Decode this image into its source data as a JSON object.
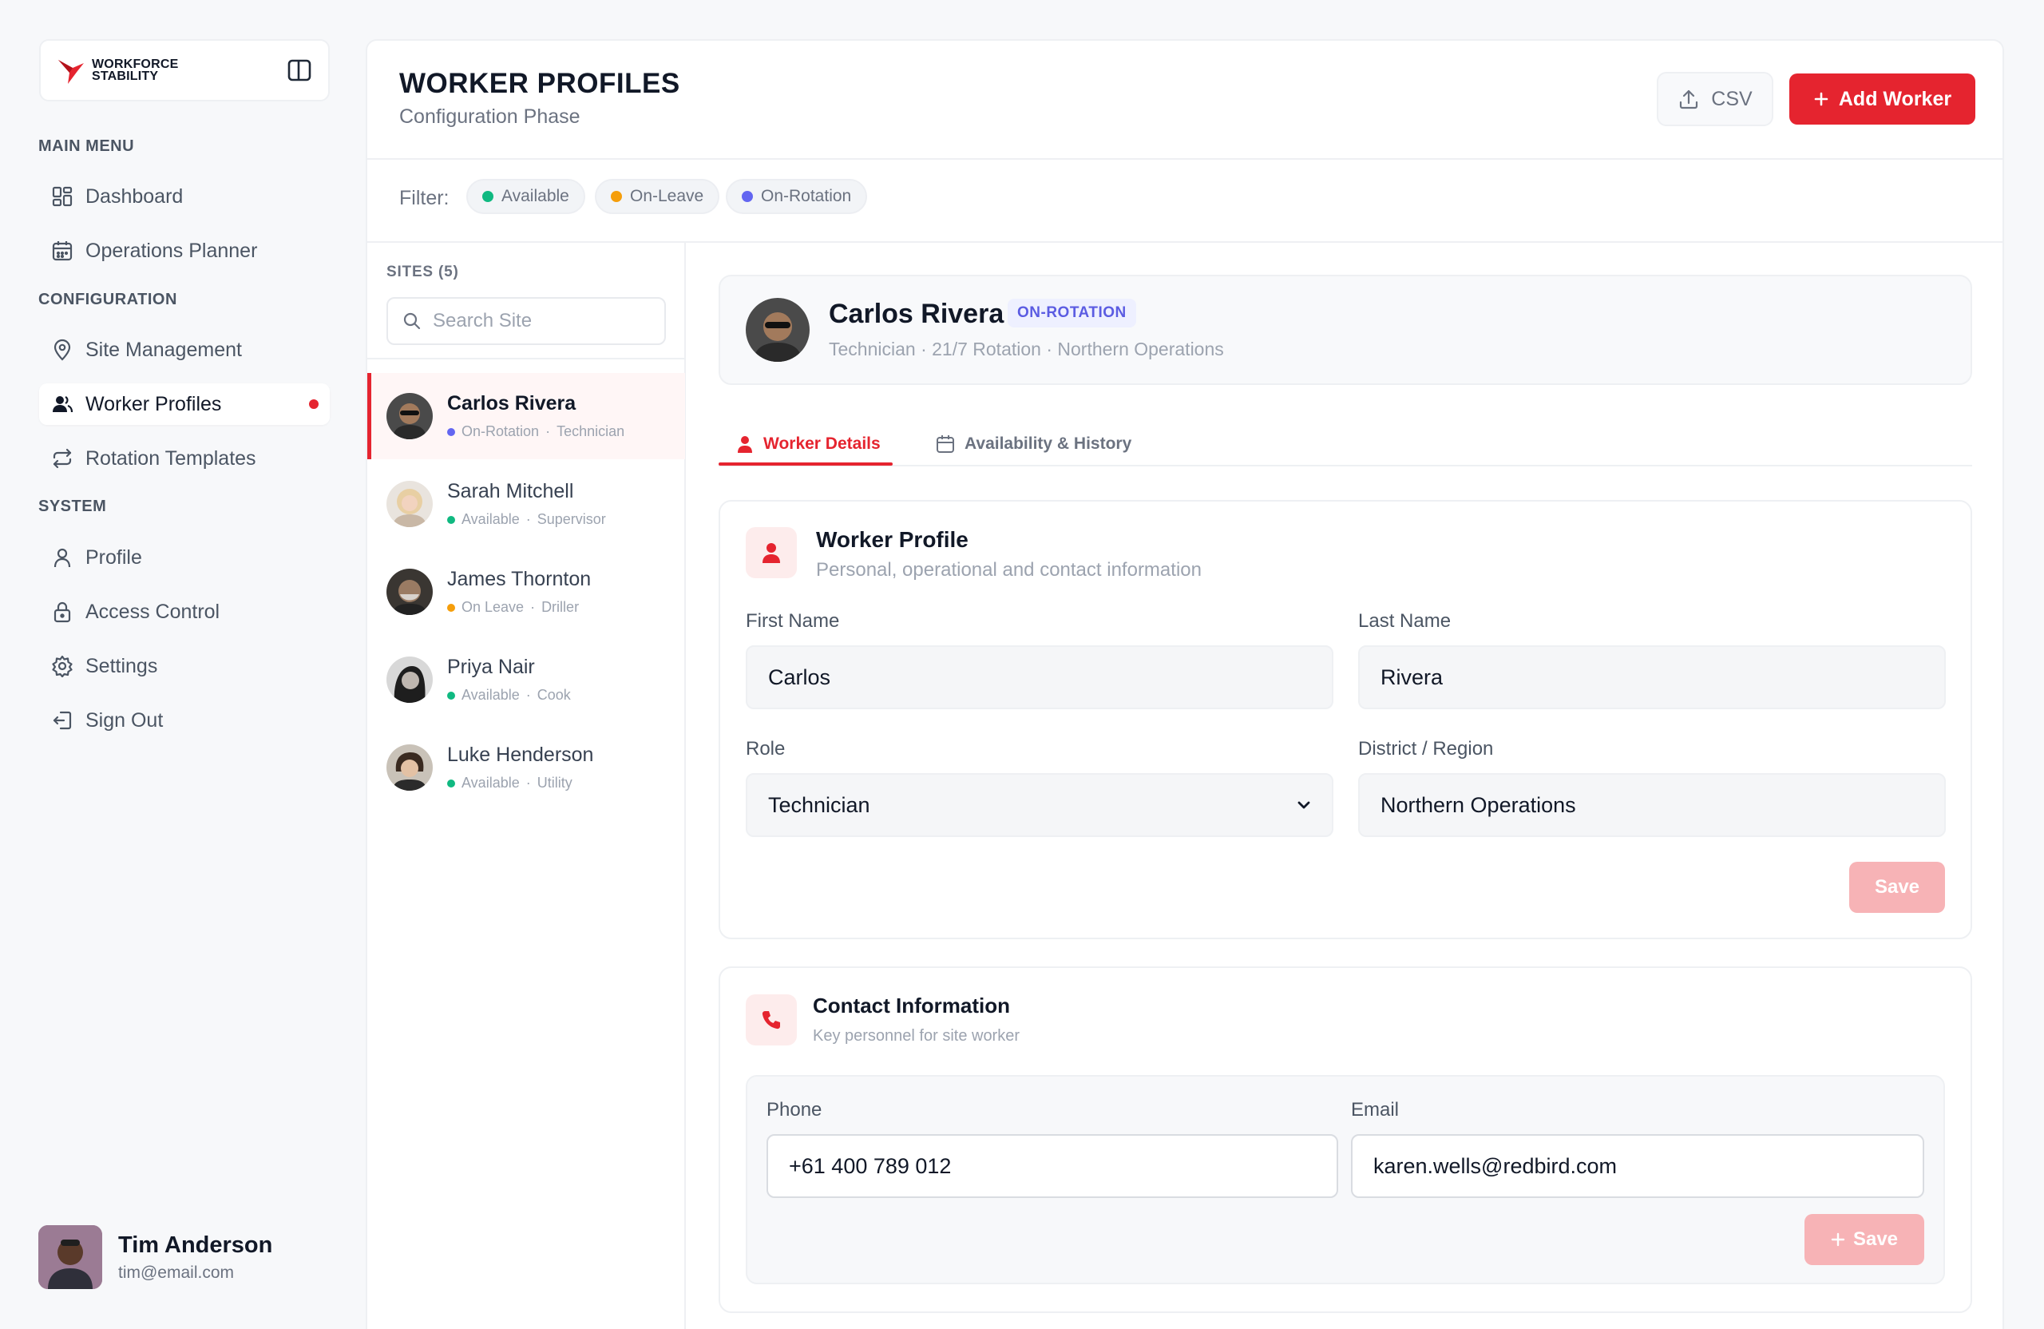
{
  "brand": {
    "line1": "WORKFORCE",
    "line2": "STABILITY"
  },
  "sidebar": {
    "sections": {
      "main": "MAIN MENU",
      "config": "CONFIGURATION",
      "system": "SYSTEM"
    },
    "items": {
      "dashboard": "Dashboard",
      "operations_planner": "Operations Planner",
      "site_management": "Site Management",
      "worker_profiles": "Worker Profiles",
      "rotation_templates": "Rotation Templates",
      "profile": "Profile",
      "access_control": "Access Control",
      "settings": "Settings",
      "sign_out": "Sign Out"
    },
    "active": "worker_profiles"
  },
  "user": {
    "name": "Tim Anderson",
    "email": "tim@email.com"
  },
  "header": {
    "title": "WORKER PROFILES",
    "subtitle": "Configuration Phase",
    "csv_label": "CSV",
    "add_label": "Add Worker"
  },
  "filter": {
    "label": "Filter:",
    "chips": [
      {
        "label": "Available",
        "color": "#10b981"
      },
      {
        "label": "On-Leave",
        "color": "#f59e0b"
      },
      {
        "label": "On-Rotation",
        "color": "#6366f1"
      }
    ]
  },
  "sites": {
    "heading": "SITES (5)",
    "search_placeholder": "Search Site",
    "workers": [
      {
        "name": "Carlos Rivera",
        "status": "On-Rotation",
        "role": "Technician",
        "status_color": "#6366f1"
      },
      {
        "name": "Sarah Mitchell",
        "status": "Available",
        "role": "Supervisor",
        "status_color": "#10b981"
      },
      {
        "name": "James Thornton",
        "status": "On Leave",
        "role": "Driller",
        "status_color": "#f59e0b"
      },
      {
        "name": "Priya Nair",
        "status": "Available",
        "role": "Cook",
        "status_color": "#10b981"
      },
      {
        "name": "Luke Henderson",
        "status": "Available",
        "role": "Utility",
        "status_color": "#10b981"
      }
    ]
  },
  "selected": {
    "name": "Carlos Rivera",
    "badge": "ON-ROTATION",
    "meta": "Technician · 21/7 Rotation · Northern Operations"
  },
  "tabs": {
    "details": "Worker Details",
    "availability": "Availability & History"
  },
  "profile_card": {
    "title": "Worker Profile",
    "subtitle": "Personal, operational and contact information",
    "first_name_label": "First Name",
    "first_name": "Carlos",
    "last_name_label": "Last Name",
    "last_name": "Rivera",
    "role_label": "Role",
    "role": "Technician",
    "district_label": "District / Region",
    "district": "Northern Operations",
    "save_label": "Save"
  },
  "contact_card": {
    "title": "Contact Information",
    "subtitle": "Key personnel for site worker",
    "phone_label": "Phone",
    "phone": "+61 400 789 012",
    "email_label": "Email",
    "email": "karen.wells@redbird.com",
    "save_label": "Save"
  },
  "colors": {
    "accent": "#e5242f",
    "available": "#10b981",
    "on_leave": "#f59e0b",
    "on_rotation": "#6366f1"
  }
}
